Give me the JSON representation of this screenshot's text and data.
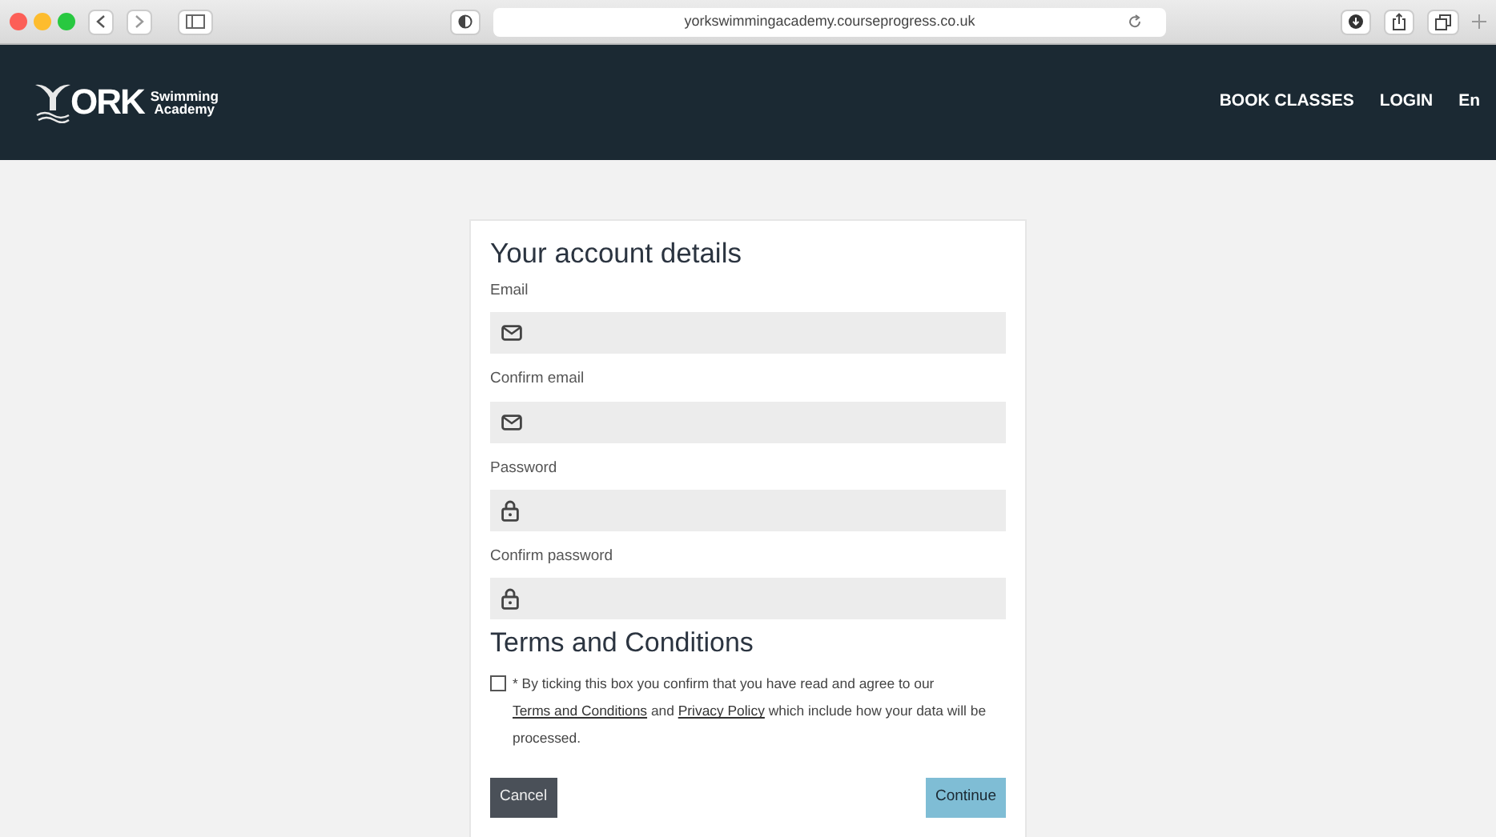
{
  "browser": {
    "url": "yorkswimmingacademy.courseprogress.co.uk"
  },
  "logo": {
    "letters": "ORK",
    "line1": "Swimming",
    "line2": "Academy"
  },
  "nav": [
    {
      "label": "BOOK CLASSES"
    },
    {
      "label": "LOGIN"
    },
    {
      "label": "En"
    }
  ],
  "form": {
    "title": "Your account details",
    "fields": [
      {
        "label": "Email",
        "kind": "email"
      },
      {
        "label": "Confirm email",
        "kind": "email"
      },
      {
        "label": "Password",
        "kind": "password"
      },
      {
        "label": "Confirm password",
        "kind": "password"
      }
    ],
    "terms_title": "Terms and Conditions",
    "consent": {
      "checked": false,
      "parts": [
        {
          "kind": "text",
          "text": "* By ticking this box you confirm that you have read and agree to our "
        },
        {
          "kind": "link",
          "text": "Terms and Conditions"
        },
        {
          "kind": "text",
          "text": " and "
        },
        {
          "kind": "link",
          "text": "Privacy Policy"
        },
        {
          "kind": "text",
          "text": " which include how your data will be processed."
        }
      ]
    },
    "buttons": [
      {
        "label": "Cancel",
        "kind": "secondary"
      },
      {
        "label": "Continue",
        "kind": "primary"
      }
    ]
  }
}
